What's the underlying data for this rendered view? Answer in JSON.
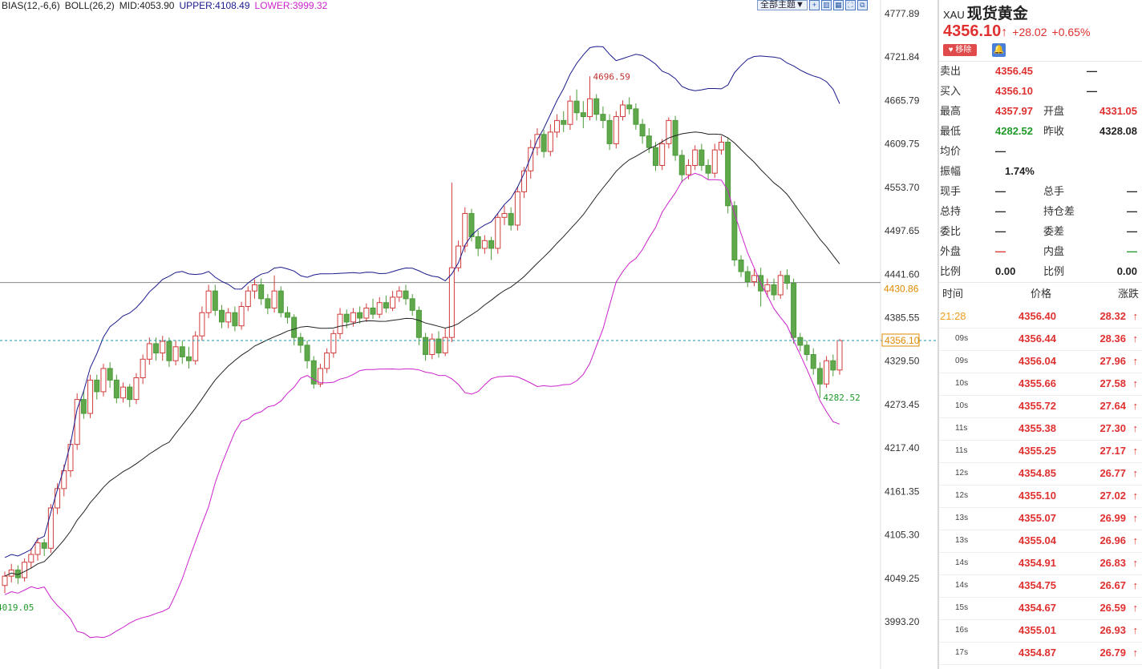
{
  "indicator": {
    "bias": "BIAS(12,-6,6)",
    "boll": "BOLL(26,2)",
    "mid": "MID:4053.90",
    "upper": "UPPER:4108.49",
    "lower": "LOWER:3999.32",
    "colors": {
      "mid": "#222222",
      "upper": "#1a1a8c",
      "lower": "#cc22cc"
    }
  },
  "toolbar": {
    "dropdown_label": "全部主题▼",
    "icons": [
      "zoom-in-icon",
      "chart-toggle-icon",
      "grid-icon",
      "fullscreen-icon",
      "expand-icon"
    ]
  },
  "chart_data": {
    "type": "candlestick",
    "y_axis_ticks": [
      "4777.89",
      "4721.84",
      "4665.79",
      "4609.75",
      "4553.70",
      "4497.65",
      "4441.60",
      "4385.55",
      "4329.50",
      "4273.45",
      "4217.40",
      "4161.35",
      "4105.30",
      "4049.25",
      "3993.20"
    ],
    "y_range": [
      3955,
      4798
    ],
    "reference_line": "4430.86",
    "current_price_label": "4356.10",
    "high_marker": "4696.59",
    "low_marker": "4282.52",
    "left_low_marker": "4019.05",
    "candles": [
      [
        4040,
        4052,
        4030,
        4058
      ],
      [
        4052,
        4060,
        4044,
        4068
      ],
      [
        4060,
        4050,
        4042,
        4066
      ],
      [
        4050,
        4070,
        4045,
        4075
      ],
      [
        4070,
        4080,
        4062,
        4088
      ],
      [
        4080,
        4095,
        4072,
        4102
      ],
      [
        4095,
        4088,
        4078,
        4100
      ],
      [
        4088,
        4140,
        4082,
        4145
      ],
      [
        4140,
        4165,
        4132,
        4172
      ],
      [
        4165,
        4188,
        4155,
        4196
      ],
      [
        4188,
        4222,
        4180,
        4228
      ],
      [
        4222,
        4280,
        4215,
        4288
      ],
      [
        4280,
        4262,
        4255,
        4292
      ],
      [
        4262,
        4305,
        4256,
        4312
      ],
      [
        4305,
        4290,
        4280,
        4312
      ],
      [
        4290,
        4320,
        4284,
        4326
      ],
      [
        4320,
        4305,
        4295,
        4328
      ],
      [
        4305,
        4282,
        4275,
        4312
      ],
      [
        4282,
        4296,
        4276,
        4302
      ],
      [
        4296,
        4280,
        4270,
        4300
      ],
      [
        4280,
        4308,
        4274,
        4314
      ],
      [
        4308,
        4332,
        4300,
        4338
      ],
      [
        4332,
        4352,
        4325,
        4360
      ],
      [
        4352,
        4340,
        4330,
        4360
      ],
      [
        4340,
        4355,
        4330,
        4362
      ],
      [
        4355,
        4330,
        4322,
        4360
      ],
      [
        4330,
        4348,
        4324,
        4356
      ],
      [
        4348,
        4335,
        4326,
        4356
      ],
      [
        4335,
        4330,
        4320,
        4348
      ],
      [
        4330,
        4362,
        4325,
        4368
      ],
      [
        4362,
        4392,
        4356,
        4400
      ],
      [
        4392,
        4420,
        4385,
        4428
      ],
      [
        4420,
        4395,
        4388,
        4428
      ],
      [
        4395,
        4380,
        4372,
        4402
      ],
      [
        4380,
        4392,
        4372,
        4398
      ],
      [
        4392,
        4375,
        4368,
        4400
      ],
      [
        4375,
        4400,
        4370,
        4406
      ],
      [
        4400,
        4420,
        4394,
        4426
      ],
      [
        4420,
        4428,
        4410,
        4435
      ],
      [
        4428,
        4410,
        4402,
        4436
      ],
      [
        4410,
        4398,
        4390,
        4416
      ],
      [
        4398,
        4420,
        4392,
        4440
      ],
      [
        4420,
        4392,
        4386,
        4426
      ],
      [
        4392,
        4386,
        4378,
        4400
      ],
      [
        4386,
        4360,
        4350,
        4390
      ],
      [
        4360,
        4350,
        4340,
        4366
      ],
      [
        4350,
        4330,
        4320,
        4356
      ],
      [
        4330,
        4300,
        4294,
        4336
      ],
      [
        4300,
        4320,
        4296,
        4326
      ],
      [
        4320,
        4340,
        4314,
        4346
      ],
      [
        4340,
        4365,
        4334,
        4370
      ],
      [
        4365,
        4390,
        4358,
        4398
      ],
      [
        4390,
        4380,
        4372,
        4396
      ],
      [
        4380,
        4392,
        4374,
        4398
      ],
      [
        4392,
        4385,
        4378,
        4400
      ],
      [
        4385,
        4398,
        4380,
        4404
      ],
      [
        4398,
        4390,
        4384,
        4410
      ],
      [
        4390,
        4405,
        4385,
        4412
      ],
      [
        4405,
        4398,
        4392,
        4414
      ],
      [
        4398,
        4412,
        4394,
        4420
      ],
      [
        4412,
        4420,
        4406,
        4426
      ],
      [
        4420,
        4410,
        4402,
        4428
      ],
      [
        4410,
        4395,
        4388,
        4416
      ],
      [
        4395,
        4360,
        4350,
        4400
      ],
      [
        4360,
        4338,
        4330,
        4366
      ],
      [
        4338,
        4358,
        4332,
        4365
      ],
      [
        4358,
        4340,
        4334,
        4368
      ],
      [
        4340,
        4360,
        4336,
        4372
      ],
      [
        4360,
        4450,
        4354,
        4560
      ],
      [
        4450,
        4478,
        4445,
        4485
      ],
      [
        4478,
        4520,
        4470,
        4528
      ],
      [
        4520,
        4490,
        4484,
        4526
      ],
      [
        4490,
        4475,
        4465,
        4498
      ],
      [
        4475,
        4485,
        4468,
        4492
      ],
      [
        4485,
        4475,
        4460,
        4490
      ],
      [
        4475,
        4515,
        4468,
        4520
      ],
      [
        4515,
        4520,
        4505,
        4530
      ],
      [
        4520,
        4505,
        4498,
        4528
      ],
      [
        4505,
        4548,
        4498,
        4554
      ],
      [
        4548,
        4575,
        4540,
        4580
      ],
      [
        4575,
        4605,
        4565,
        4615
      ],
      [
        4605,
        4622,
        4595,
        4630
      ],
      [
        4622,
        4600,
        4592,
        4628
      ],
      [
        4600,
        4625,
        4594,
        4635
      ],
      [
        4625,
        4640,
        4618,
        4648
      ],
      [
        4640,
        4635,
        4625,
        4652
      ],
      [
        4635,
        4665,
        4628,
        4672
      ],
      [
        4665,
        4650,
        4640,
        4680
      ],
      [
        4650,
        4645,
        4630,
        4665
      ],
      [
        4645,
        4668,
        4640,
        4697
      ],
      [
        4668,
        4648,
        4640,
        4674
      ],
      [
        4648,
        4640,
        4630,
        4658
      ],
      [
        4640,
        4610,
        4602,
        4648
      ],
      [
        4610,
        4645,
        4604,
        4652
      ],
      [
        4645,
        4660,
        4640,
        4666
      ],
      [
        4660,
        4655,
        4648,
        4670
      ],
      [
        4655,
        4635,
        4628,
        4662
      ],
      [
        4635,
        4620,
        4610,
        4642
      ],
      [
        4620,
        4605,
        4598,
        4630
      ],
      [
        4605,
        4582,
        4575,
        4612
      ],
      [
        4582,
        4610,
        4576,
        4616
      ],
      [
        4610,
        4640,
        4604,
        4644
      ],
      [
        4640,
        4595,
        4588,
        4646
      ],
      [
        4595,
        4570,
        4560,
        4602
      ],
      [
        4570,
        4582,
        4564,
        4590
      ],
      [
        4582,
        4602,
        4576,
        4608
      ],
      [
        4602,
        4582,
        4575,
        4610
      ],
      [
        4582,
        4572,
        4564,
        4590
      ],
      [
        4572,
        4602,
        4566,
        4610
      ],
      [
        4602,
        4612,
        4596,
        4620
      ],
      [
        4612,
        4530,
        4520,
        4618
      ],
      [
        4530,
        4460,
        4452,
        4536
      ],
      [
        4460,
        4445,
        4438,
        4466
      ],
      [
        4445,
        4432,
        4425,
        4452
      ],
      [
        4432,
        4440,
        4426,
        4448
      ],
      [
        4440,
        4420,
        4400,
        4450
      ],
      [
        4420,
        4428,
        4412,
        4436
      ],
      [
        4428,
        4415,
        4408,
        4436
      ],
      [
        4415,
        4440,
        4410,
        4446
      ],
      [
        4440,
        4430,
        4422,
        4448
      ],
      [
        4430,
        4360,
        4352,
        4436
      ],
      [
        4360,
        4350,
        4342,
        4366
      ],
      [
        4350,
        4338,
        4330,
        4356
      ],
      [
        4338,
        4320,
        4312,
        4346
      ],
      [
        4320,
        4300,
        4282,
        4328
      ],
      [
        4300,
        4330,
        4295,
        4336
      ],
      [
        4330,
        4318,
        4310,
        4338
      ],
      [
        4318,
        4356,
        4312,
        4358
      ]
    ]
  },
  "quote": {
    "code": "XAU",
    "name": "现货黄金",
    "price": "4356.10",
    "arrow": "↑",
    "change": "+28.02",
    "change_pct": "+0.65%",
    "remove_label": "移除",
    "rows": [
      {
        "l1": "卖出",
        "v1": "4356.45",
        "c1": "red",
        "l2": "",
        "v2": "—",
        "c2": "black"
      },
      {
        "l1": "买入",
        "v1": "4356.10",
        "c1": "red",
        "l2": "",
        "v2": "—",
        "c2": "black"
      },
      {
        "l1": "最高",
        "v1": "4357.97",
        "c1": "red",
        "l2": "开盘",
        "v2": "4331.05",
        "c2": "red"
      },
      {
        "l1": "最低",
        "v1": "4282.52",
        "c1": "green",
        "l2": "昨收",
        "v2": "4328.08",
        "c2": "black"
      },
      {
        "l1": "均价",
        "v1": "—",
        "c1": "black",
        "l2": "",
        "v2": "",
        "c2": "black"
      },
      {
        "l1": "振幅",
        "v1": "1.74%",
        "c1": "black",
        "l2": "",
        "v2": "",
        "c2": "black"
      },
      {
        "l1": "现手",
        "v1": "—",
        "c1": "black",
        "l2": "总手",
        "v2": "—",
        "c2": "black"
      },
      {
        "l1": "总持",
        "v1": "—",
        "c1": "black",
        "l2": "持仓差",
        "v2": "—",
        "c2": "black"
      },
      {
        "l1": "委比",
        "v1": "—",
        "c1": "black",
        "l2": "委差",
        "v2": "—",
        "c2": "black"
      },
      {
        "l1": "外盘",
        "v1": "—",
        "c1": "red",
        "l2": "内盘",
        "v2": "—",
        "c2": "green"
      },
      {
        "l1": "比例",
        "v1": "0.00",
        "c1": "black",
        "l2": "比例",
        "v2": "0.00",
        "c2": "black"
      }
    ]
  },
  "ticks": {
    "headers": {
      "time": "时间",
      "price": "价格",
      "change": "涨跌"
    },
    "rows": [
      {
        "time": "21:28",
        "price": "4356.40",
        "change": "28.32"
      },
      {
        "time": "09s",
        "price": "4356.44",
        "change": "28.36"
      },
      {
        "time": "09s",
        "price": "4356.04",
        "change": "27.96"
      },
      {
        "time": "10s",
        "price": "4355.66",
        "change": "27.58"
      },
      {
        "time": "10s",
        "price": "4355.72",
        "change": "27.64"
      },
      {
        "time": "11s",
        "price": "4355.38",
        "change": "27.30"
      },
      {
        "time": "11s",
        "price": "4355.25",
        "change": "27.17"
      },
      {
        "time": "12s",
        "price": "4354.85",
        "change": "26.77"
      },
      {
        "time": "12s",
        "price": "4355.10",
        "change": "27.02"
      },
      {
        "time": "13s",
        "price": "4355.07",
        "change": "26.99"
      },
      {
        "time": "13s",
        "price": "4355.04",
        "change": "26.96"
      },
      {
        "time": "14s",
        "price": "4354.91",
        "change": "26.83"
      },
      {
        "time": "14s",
        "price": "4354.75",
        "change": "26.67"
      },
      {
        "time": "15s",
        "price": "4354.67",
        "change": "26.59"
      },
      {
        "time": "16s",
        "price": "4355.01",
        "change": "26.93"
      },
      {
        "time": "17s",
        "price": "4354.87",
        "change": "26.79"
      }
    ]
  }
}
